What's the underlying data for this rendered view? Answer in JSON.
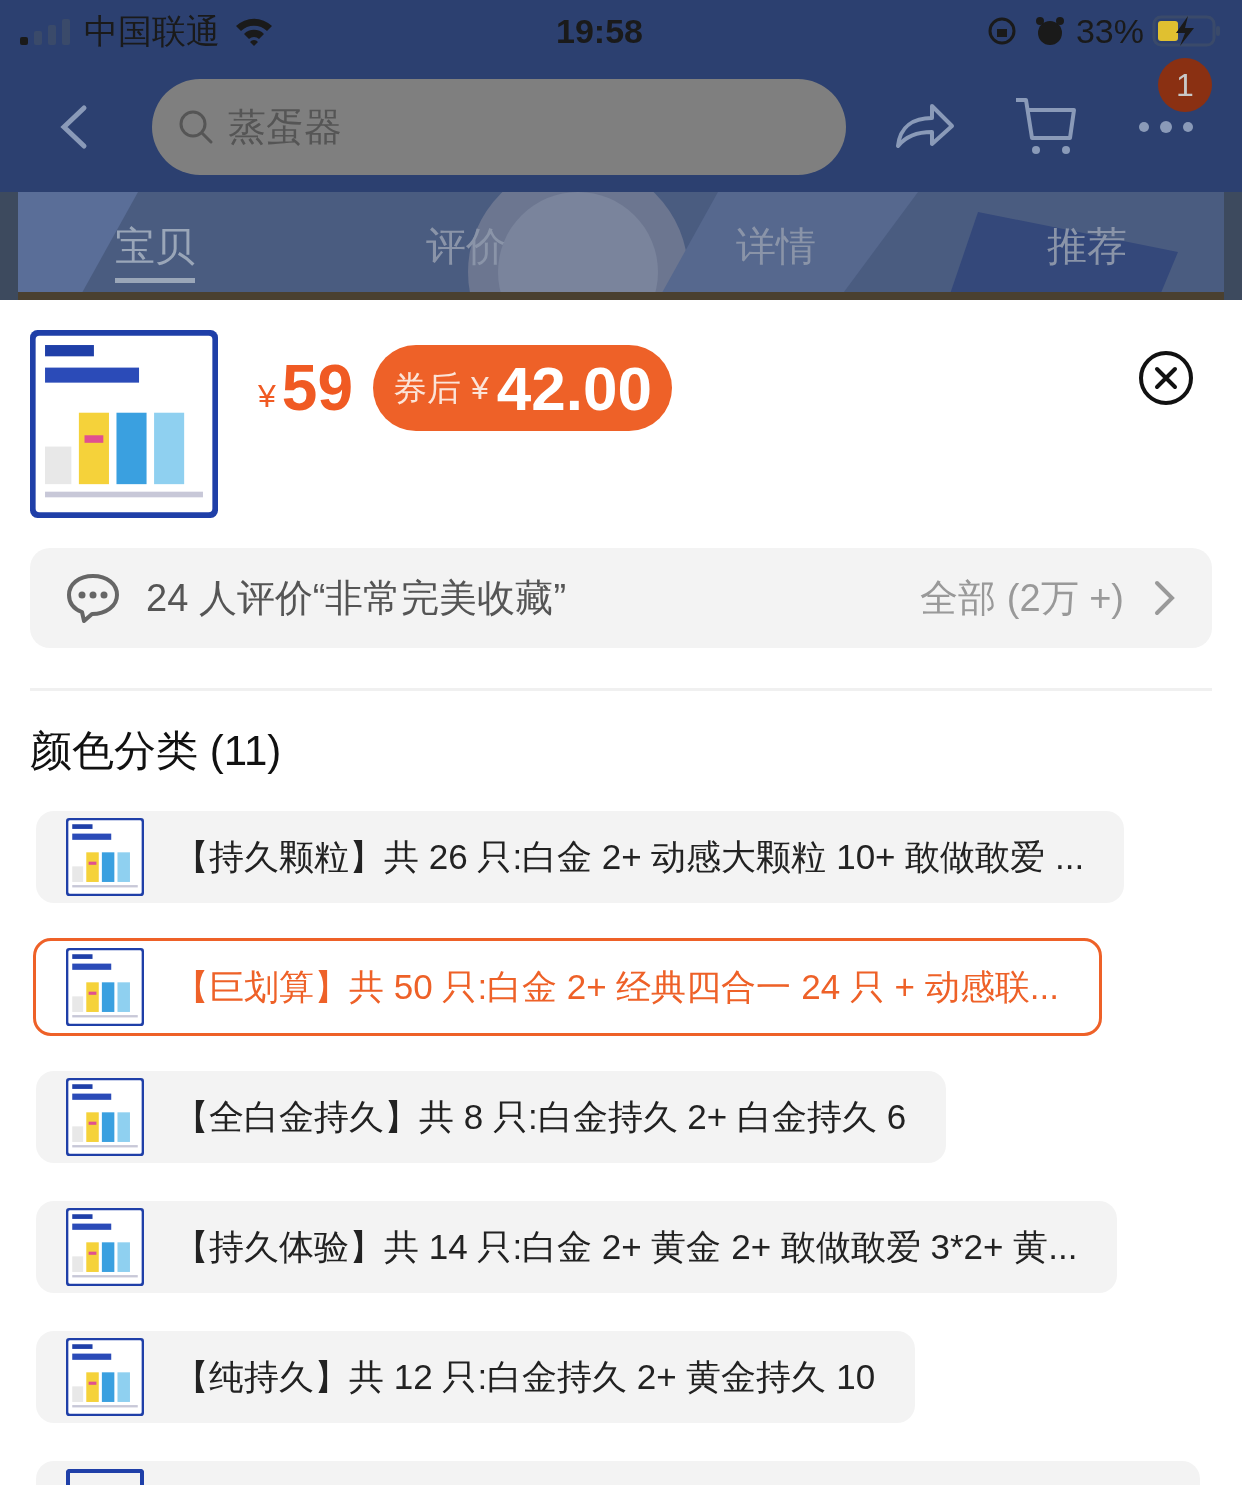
{
  "status_bar": {
    "carrier": "中国联通",
    "time": "19:58",
    "battery": "33%"
  },
  "nav": {
    "search": {
      "placeholder": "蒸蛋器"
    },
    "menu_badge": "1"
  },
  "tabs": [
    {
      "label": "宝贝",
      "selected": true
    },
    {
      "label": "评价",
      "selected": false
    },
    {
      "label": "详情",
      "selected": false
    },
    {
      "label": "推荐",
      "selected": false
    }
  ],
  "sheet": {
    "currency": "¥",
    "price": "59",
    "coupon": {
      "label": "券后",
      "currency": "¥",
      "price": "42.00"
    },
    "review": {
      "text": "24 人评价“非常完美收藏”",
      "all": "全部 (2万 +)"
    },
    "section_title": "颜色分类 (11)",
    "options": [
      {
        "label": "【持久颗粒】共 26 只:白金 2+ 动感大颗粒 10+ 敢做敢爱 ...",
        "selected": false
      },
      {
        "label": "【巨划算】共 50 只:白金 2+ 经典四合一 24 只 + 动感联...",
        "selected": true
      },
      {
        "label": "【全白金持久】共 8 只:白金持久 2+ 白金持久 6",
        "selected": false
      },
      {
        "label": "【持久体验】共 14 只:白金 2+ 黄金 2+ 敢做敢爱 3*2+ 黄...",
        "selected": false
      },
      {
        "label": "【纯持久】共 12 只:白金持久 2+ 黄金持久 10",
        "selected": false
      }
    ]
  }
}
